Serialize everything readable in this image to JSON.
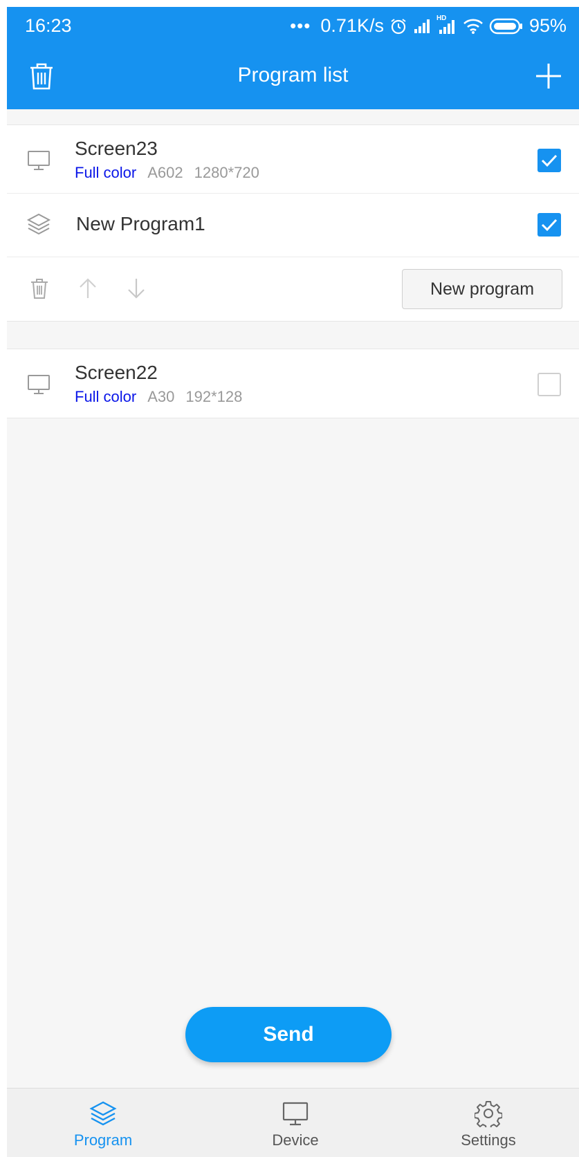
{
  "status": {
    "time": "16:23",
    "dots": "•••",
    "net_speed": "0.71K/s",
    "battery": "95%",
    "hd": "HD"
  },
  "header": {
    "title": "Program list"
  },
  "screens": [
    {
      "name": "Screen23",
      "type": "Full color",
      "model": "A602",
      "resolution": "1280*720",
      "checked": true,
      "program": {
        "name": "New Program1",
        "checked": true
      },
      "new_program_label": "New program"
    },
    {
      "name": "Screen22",
      "type": "Full color",
      "model": "A30",
      "resolution": "192*128",
      "checked": false
    }
  ],
  "send_label": "Send",
  "nav": {
    "program": "Program",
    "device": "Device",
    "settings": "Settings"
  },
  "colors": {
    "accent": "#1692f0",
    "type_text": "#0a16e8",
    "send": "#0d9cf5"
  },
  "icons": [
    "trash-icon",
    "plus-icon",
    "monitor-icon",
    "layers-icon",
    "arrow-up-icon",
    "arrow-down-icon",
    "gear-icon"
  ]
}
